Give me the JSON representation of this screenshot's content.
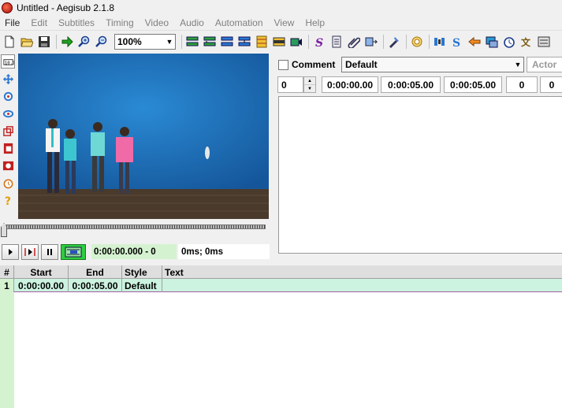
{
  "window": {
    "title": "Untitled - Aegisub 2.1.8"
  },
  "menu": [
    "File",
    "Edit",
    "Subtitles",
    "Timing",
    "Video",
    "Audio",
    "Automation",
    "View",
    "Help"
  ],
  "toolbar": {
    "zoom_value": "100%",
    "icons": [
      "new-file-icon",
      "open-file-icon",
      "save-file-icon",
      "jump-to-icon",
      "zoom-in-icon",
      "zoom-out-icon",
      "split-icon-1",
      "split-icon-2",
      "split-icon-3",
      "split-icon-4",
      "split-icon-5",
      "snap-icon",
      "video-clip-icon",
      "styles-icon",
      "properties-icon",
      "attachments-icon",
      "fonts-collector-icon",
      "automation-icon",
      "translation-assistant-icon",
      "spell-check-icon",
      "timing-processor-icon",
      "kanji-timer-icon",
      "resample-icon",
      "shift-times-icon",
      "select-lines-icon",
      "options-icon"
    ]
  },
  "video_tools": [
    "standard-tool-icon",
    "drag-tool-icon",
    "rotate-z-icon",
    "rotate-xy-icon",
    "scale-icon",
    "clip-icon",
    "vector-clip-icon",
    "realtime-icon",
    "help-icon"
  ],
  "video_controls": {
    "time": "0:00:00.000 - 0",
    "offset": "0ms; 0ms"
  },
  "edit": {
    "comment_label": "Comment",
    "style": "Default",
    "actor_placeholder": "Actor",
    "layer": "0",
    "start": "0:00:00.00",
    "end": "0:00:05.00",
    "duration": "0:00:05.00",
    "margin_l": "0",
    "margin_r": "0"
  },
  "grid": {
    "headers": {
      "num": "#",
      "start": "Start",
      "end": "End",
      "style": "Style",
      "text": "Text"
    },
    "rows": [
      {
        "num": "1",
        "start": "0:00:00.00",
        "end": "0:00:05.00",
        "style": "Default",
        "text": ""
      }
    ]
  },
  "colors": {
    "accent_green": "#d5f2d0",
    "row_selected": "#ccf2e0",
    "video_wall": "#1f6fb5"
  }
}
